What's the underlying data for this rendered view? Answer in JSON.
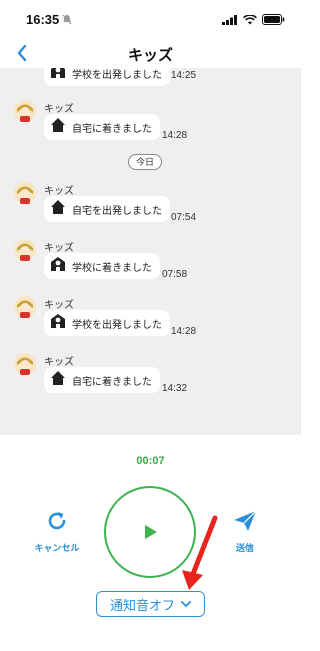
{
  "status_bar": {
    "time": "16:35"
  },
  "nav": {
    "title": "キッズ"
  },
  "chat": {
    "date_divider": "今日",
    "messages": [
      {
        "sender": "",
        "text": "学校を出発しました",
        "time": "14:25",
        "icon": "school-icon"
      },
      {
        "sender": "キッズ",
        "text": "自宅に着きました",
        "time": "14:28",
        "icon": "home-icon"
      },
      {
        "sender": "キッズ",
        "text": "自宅を出発しました",
        "time": "07:54",
        "icon": "home-icon"
      },
      {
        "sender": "キッズ",
        "text": "学校に着きました",
        "time": "07:58",
        "icon": "school-icon"
      },
      {
        "sender": "キッズ",
        "text": "学校を出発しました",
        "time": "14:28",
        "icon": "school-icon"
      },
      {
        "sender": "キッズ",
        "text": "自宅に着きました",
        "time": "14:32",
        "icon": "home-icon"
      }
    ]
  },
  "player": {
    "timer": "00:07",
    "cancel_label": "キャンセル",
    "send_label": "送信",
    "notify_label": "通知音オフ"
  },
  "colors": {
    "accent_blue": "#2a8fd8",
    "accent_green": "#3db34f",
    "annotation_red": "#e8241c"
  }
}
